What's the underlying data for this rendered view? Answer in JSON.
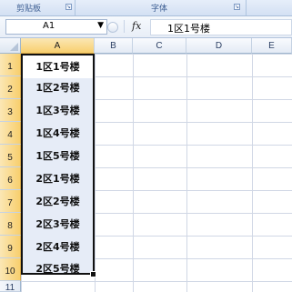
{
  "ribbon": {
    "groups": [
      {
        "label": "剪贴板"
      },
      {
        "label": "字体"
      }
    ],
    "launcher_icon": "dialog-launcher-icon"
  },
  "formula_bar": {
    "name_box": "A1",
    "fx_label": "fx",
    "formula": "1区1号楼"
  },
  "columns": [
    "A",
    "B",
    "C",
    "D",
    "E"
  ],
  "rows": [
    "1",
    "2",
    "3",
    "4",
    "5",
    "6",
    "7",
    "8",
    "9",
    "10",
    "11"
  ],
  "cells": [
    "1区1号楼",
    "1区2号楼",
    "1区3号楼",
    "1区4号楼",
    "1区5号楼",
    "2区1号楼",
    "2区2号楼",
    "2区3号楼",
    "2区4号楼",
    "2区5号楼"
  ],
  "selection": {
    "range_start": "A1",
    "range_end": "A10"
  },
  "colors": {
    "selected_header": "#f8cf6e",
    "selection_fill": "#e6ecf7",
    "ribbon": "#d3e0f3"
  }
}
